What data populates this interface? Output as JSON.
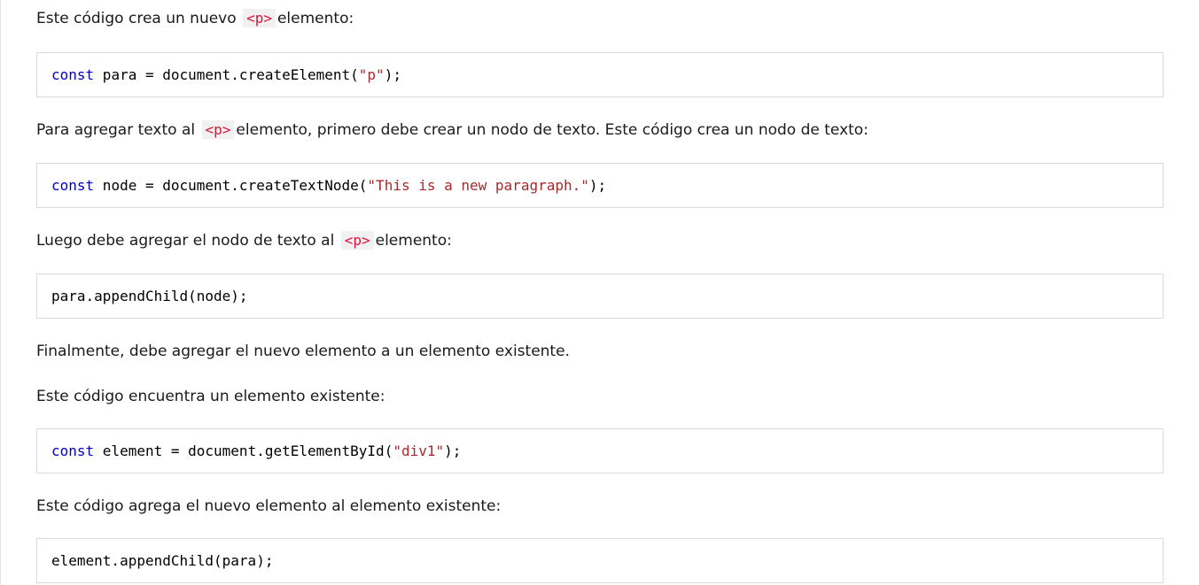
{
  "paragraphs": {
    "p1_before": "Este código crea un nuevo",
    "p1_code": "<p>",
    "p1_after": "elemento:",
    "p2_before": "Para agregar texto al",
    "p2_code": "<p>",
    "p2_after": "elemento, primero debe crear un nodo de texto. Este código crea un nodo de texto:",
    "p3_before": "Luego debe agregar el nodo de texto al",
    "p3_code": "<p>",
    "p3_after": "elemento:",
    "p4": "Finalmente, debe agregar el nuevo elemento a un elemento existente.",
    "p5": "Este código encuentra un elemento existente:",
    "p6": "Este código agrega el nuevo elemento al elemento existente:"
  },
  "code_blocks": {
    "block1": {
      "keyword": "const",
      "rest": " para = document.createElement(",
      "string": "\"p\"",
      "end": ");"
    },
    "block2": {
      "keyword": "const",
      "rest": " node = document.createTextNode(",
      "string": "\"This is a new paragraph.\"",
      "end": ");"
    },
    "block3": {
      "plain": "para.appendChild(node);"
    },
    "block4": {
      "keyword": "const",
      "rest": " element = document.getElementById(",
      "string": "\"div1\"",
      "end": ");"
    },
    "block5": {
      "plain": "element.appendChild(para);"
    }
  },
  "colors": {
    "keyword": "#0000cd",
    "string": "#a52a2a",
    "inline_code": "#dc143c",
    "inline_code_bg": "#f1f1f1",
    "code_border": "#dadada"
  }
}
